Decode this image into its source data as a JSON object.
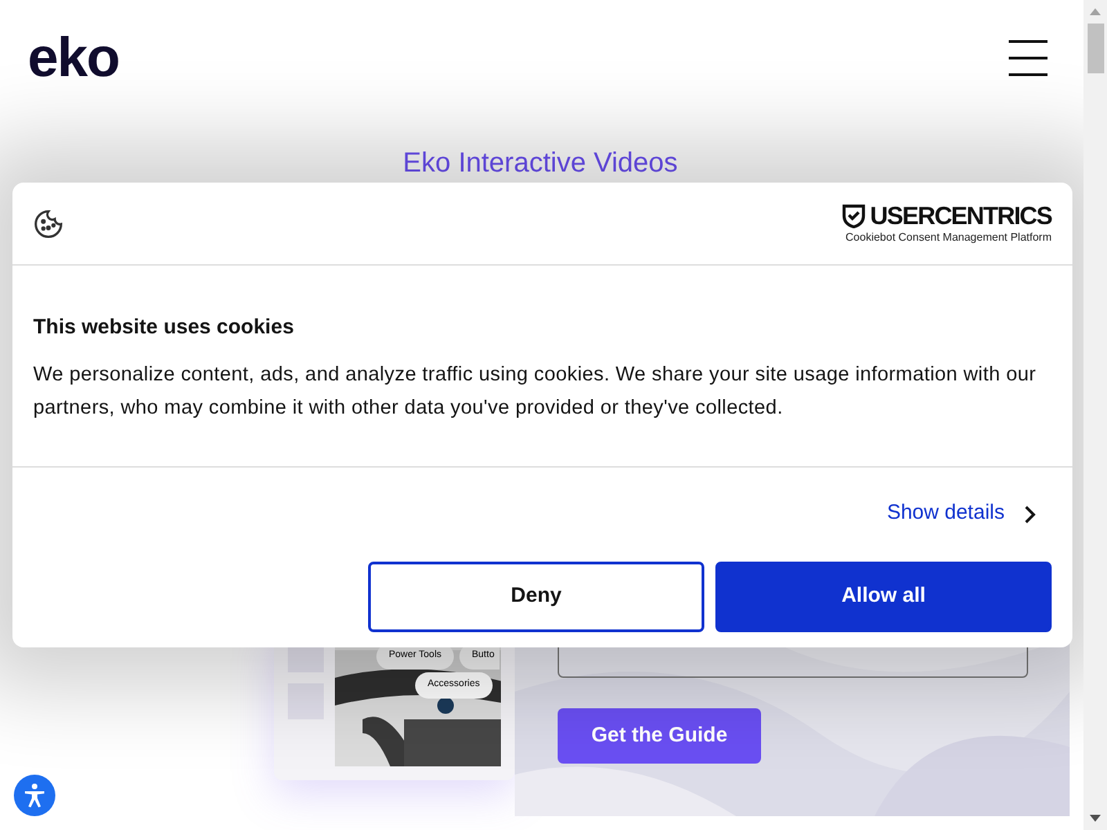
{
  "header": {
    "logo": "eko"
  },
  "page_title": "Eko Interactive Videos",
  "product_card": {
    "tags": [
      "Power Tools",
      "Butto",
      "Accessories"
    ]
  },
  "guide_form": {
    "submit": "Get the Guide"
  },
  "cookie_dialog": {
    "brand": "USERCENTRICS",
    "brand_subtitle": "Cookiebot Consent Management Platform",
    "heading": "This website uses cookies",
    "body": "We personalize content, ads, and analyze traffic using cookies. We share your site usage information with our partners, who may combine it with other data you've provided or they've collected.",
    "details_link": "Show details",
    "buttons": [
      {
        "label": "Deny",
        "kind": "outline"
      },
      {
        "label": "Allow all",
        "kind": "primary"
      }
    ]
  }
}
